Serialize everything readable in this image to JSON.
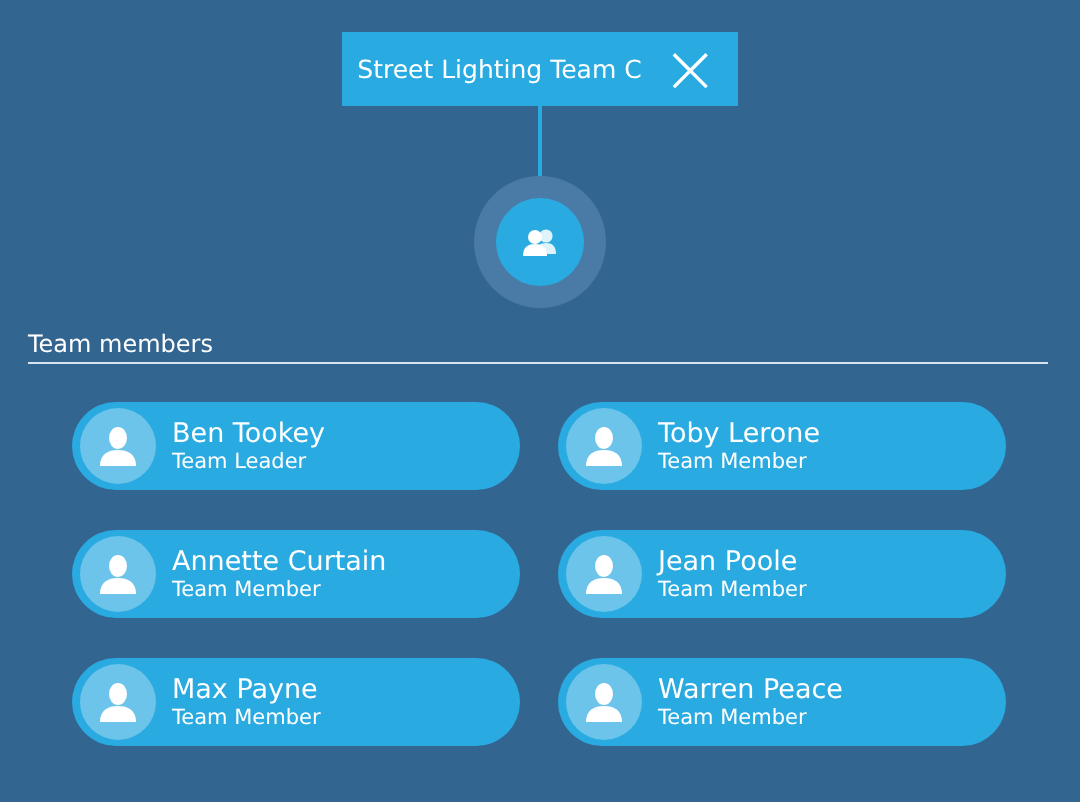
{
  "team": {
    "name": "Street Lighting Team C",
    "close": "×"
  },
  "section_title": "Team members",
  "members": [
    {
      "name": "Ben Tookey",
      "role": "Team Leader"
    },
    {
      "name": "Toby Lerone",
      "role": "Team Member"
    },
    {
      "name": "Annette Curtain",
      "role": "Team Member"
    },
    {
      "name": "Jean Poole",
      "role": "Team Member"
    },
    {
      "name": "Max Payne",
      "role": "Team Member"
    },
    {
      "name": "Warren Peace",
      "role": "Team Member"
    }
  ]
}
